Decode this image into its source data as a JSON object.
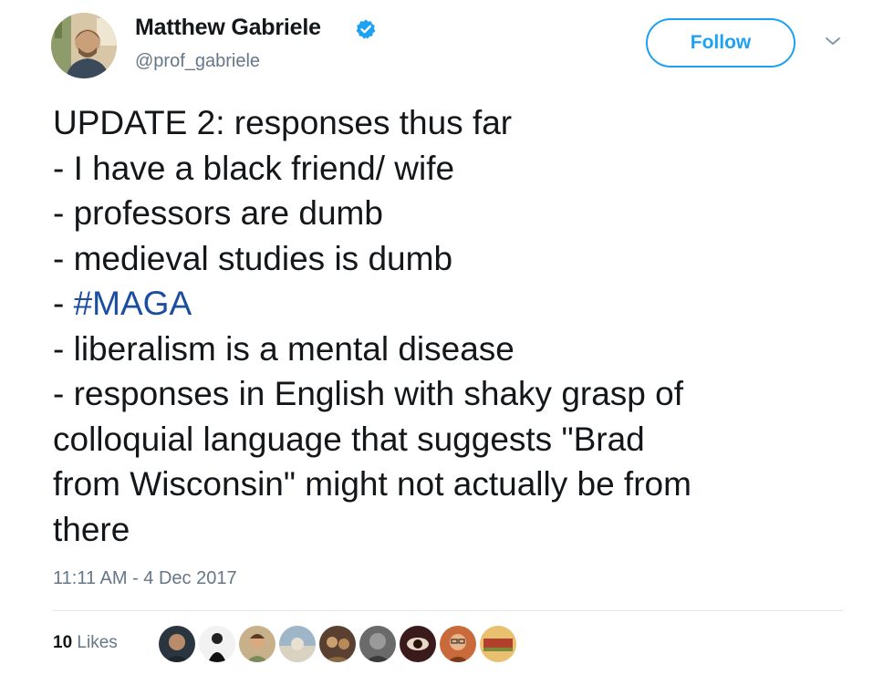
{
  "user": {
    "display_name": "Matthew Gabriele",
    "handle": "@prof_gabriele",
    "verified_icon": "verified-badge-icon",
    "avatar_icon": "profile-photo"
  },
  "follow_button": {
    "label": "Follow"
  },
  "menu_icon": "chevron-down-icon",
  "tweet": {
    "lines": [
      "UPDATE 2: responses thus far",
      "- I have a black friend/ wife",
      "- professors are dumb",
      "- medieval studies is dumb"
    ],
    "hashtag_prefix": "- ",
    "hashtag": "#MAGA",
    "lines_after": [
      "- liberalism is a mental disease",
      "- responses in English with shaky grasp of",
      "colloquial language that suggests \"Brad",
      "from Wisconsin\" might not actually be from",
      "there"
    ]
  },
  "timestamp": "11:11 AM - 4 Dec 2017",
  "likes": {
    "count": "10",
    "label": "Likes"
  },
  "colors": {
    "accent": "#1da1f2",
    "hashtag": "#1b4ea0",
    "muted": "#657786",
    "text": "#14171a"
  },
  "liker_avatars": [
    "liker-avatar",
    "liker-avatar",
    "liker-avatar",
    "liker-avatar",
    "liker-avatar",
    "liker-avatar",
    "liker-avatar",
    "liker-avatar",
    "liker-avatar"
  ]
}
